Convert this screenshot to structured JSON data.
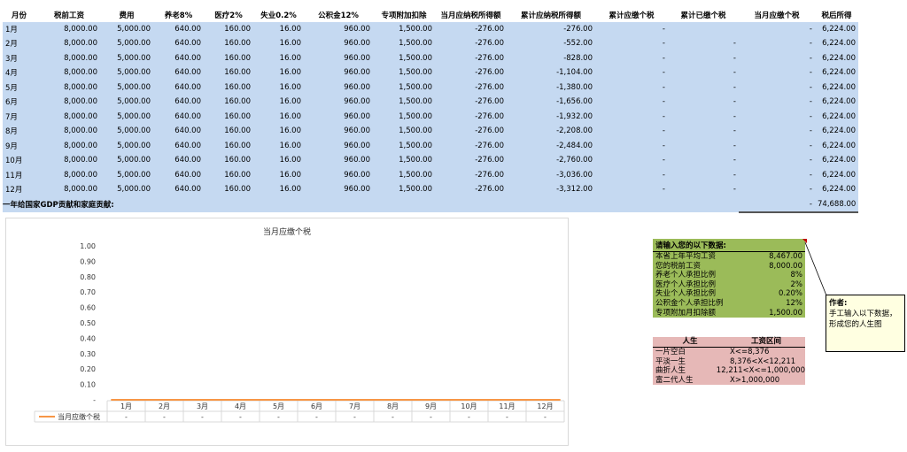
{
  "table": {
    "headers": [
      "月份",
      "税前工资",
      "费用",
      "养老8%",
      "医疗2%",
      "失业0.2%",
      "公积金12%",
      "专项附加扣除",
      "当月应纳税所得额",
      "累计应纳税所得额",
      "累计应缴个税",
      "累计已缴个税",
      "当月应缴个税",
      "税后所得"
    ],
    "rows": [
      [
        "1月",
        "8,000.00",
        "5,000.00",
        "640.00",
        "160.00",
        "16.00",
        "960.00",
        "1,500.00",
        "-276.00",
        "-276.00",
        "-",
        "",
        "-",
        "6,224.00"
      ],
      [
        "2月",
        "8,000.00",
        "5,000.00",
        "640.00",
        "160.00",
        "16.00",
        "960.00",
        "1,500.00",
        "-276.00",
        "-552.00",
        "-",
        "-",
        "-",
        "6,224.00"
      ],
      [
        "3月",
        "8,000.00",
        "5,000.00",
        "640.00",
        "160.00",
        "16.00",
        "960.00",
        "1,500.00",
        "-276.00",
        "-828.00",
        "-",
        "-",
        "-",
        "6,224.00"
      ],
      [
        "4月",
        "8,000.00",
        "5,000.00",
        "640.00",
        "160.00",
        "16.00",
        "960.00",
        "1,500.00",
        "-276.00",
        "-1,104.00",
        "-",
        "-",
        "-",
        "6,224.00"
      ],
      [
        "5月",
        "8,000.00",
        "5,000.00",
        "640.00",
        "160.00",
        "16.00",
        "960.00",
        "1,500.00",
        "-276.00",
        "-1,380.00",
        "-",
        "-",
        "-",
        "6,224.00"
      ],
      [
        "6月",
        "8,000.00",
        "5,000.00",
        "640.00",
        "160.00",
        "16.00",
        "960.00",
        "1,500.00",
        "-276.00",
        "-1,656.00",
        "-",
        "-",
        "-",
        "6,224.00"
      ],
      [
        "7月",
        "8,000.00",
        "5,000.00",
        "640.00",
        "160.00",
        "16.00",
        "960.00",
        "1,500.00",
        "-276.00",
        "-1,932.00",
        "-",
        "-",
        "-",
        "6,224.00"
      ],
      [
        "8月",
        "8,000.00",
        "5,000.00",
        "640.00",
        "160.00",
        "16.00",
        "960.00",
        "1,500.00",
        "-276.00",
        "-2,208.00",
        "-",
        "-",
        "-",
        "6,224.00"
      ],
      [
        "9月",
        "8,000.00",
        "5,000.00",
        "640.00",
        "160.00",
        "16.00",
        "960.00",
        "1,500.00",
        "-276.00",
        "-2,484.00",
        "-",
        "-",
        "-",
        "6,224.00"
      ],
      [
        "10月",
        "8,000.00",
        "5,000.00",
        "640.00",
        "160.00",
        "16.00",
        "960.00",
        "1,500.00",
        "-276.00",
        "-2,760.00",
        "-",
        "-",
        "-",
        "6,224.00"
      ],
      [
        "11月",
        "8,000.00",
        "5,000.00",
        "640.00",
        "160.00",
        "16.00",
        "960.00",
        "1,500.00",
        "-276.00",
        "-3,036.00",
        "-",
        "-",
        "-",
        "6,224.00"
      ],
      [
        "12月",
        "8,000.00",
        "5,000.00",
        "640.00",
        "160.00",
        "16.00",
        "960.00",
        "1,500.00",
        "-276.00",
        "-3,312.00",
        "-",
        "-",
        "-",
        "6,224.00"
      ]
    ],
    "summary_label": "一年给国家GDP贡献和家庭贡献:",
    "summary_tax": "-",
    "summary_net": "74,688.00"
  },
  "chart_data": {
    "type": "line",
    "title": "当月应缴个税",
    "categories": [
      "1月",
      "2月",
      "3月",
      "4月",
      "5月",
      "6月",
      "7月",
      "8月",
      "9月",
      "10月",
      "11月",
      "12月"
    ],
    "series": [
      {
        "name": "当月应缴个税",
        "values": [
          0,
          0,
          0,
          0,
          0,
          0,
          0,
          0,
          0,
          0,
          0,
          0
        ],
        "labels": [
          "-",
          "-",
          "-",
          "-",
          "-",
          "-",
          "-",
          "-",
          "-",
          "-",
          "-",
          "-"
        ],
        "color": "#f79646"
      }
    ],
    "yticks": [
      "1.00",
      "0.90",
      "0.80",
      "0.70",
      "0.60",
      "0.50",
      "0.40",
      "0.30",
      "0.20",
      "0.10",
      "-"
    ],
    "ylim": [
      0,
      1
    ],
    "grid": false,
    "legend": "data-table"
  },
  "inputs": {
    "title": "请输入您的以下数据:",
    "items": [
      {
        "label": "本省上年平均工资",
        "value": "8,467.00"
      },
      {
        "label": "您的税前工资",
        "value": "8,000.00"
      },
      {
        "label": "养老个人承担比例",
        "value": "8%"
      },
      {
        "label": "医疗个人承担比例",
        "value": "2%"
      },
      {
        "label": "失业个人承担比例",
        "value": "0.20%"
      },
      {
        "label": "公积金个人承担比例",
        "value": "12%"
      },
      {
        "label": "专项附加月扣除额",
        "value": "1,500.00"
      }
    ],
    "color": "#9bbb59"
  },
  "life": {
    "headers": [
      "人生",
      "工资区间"
    ],
    "rows": [
      [
        "一片空白",
        "X<=8,376"
      ],
      [
        "平淡一生",
        "8,376<X<12,211"
      ],
      [
        "曲折人生",
        "12,211<X<=1,000,000"
      ],
      [
        "富二代人生",
        "X>1,000,000"
      ]
    ],
    "color": "#e6b8b7"
  },
  "comment": {
    "author": "作者:",
    "text": "手工输入以下数据，形成您的人生图"
  }
}
